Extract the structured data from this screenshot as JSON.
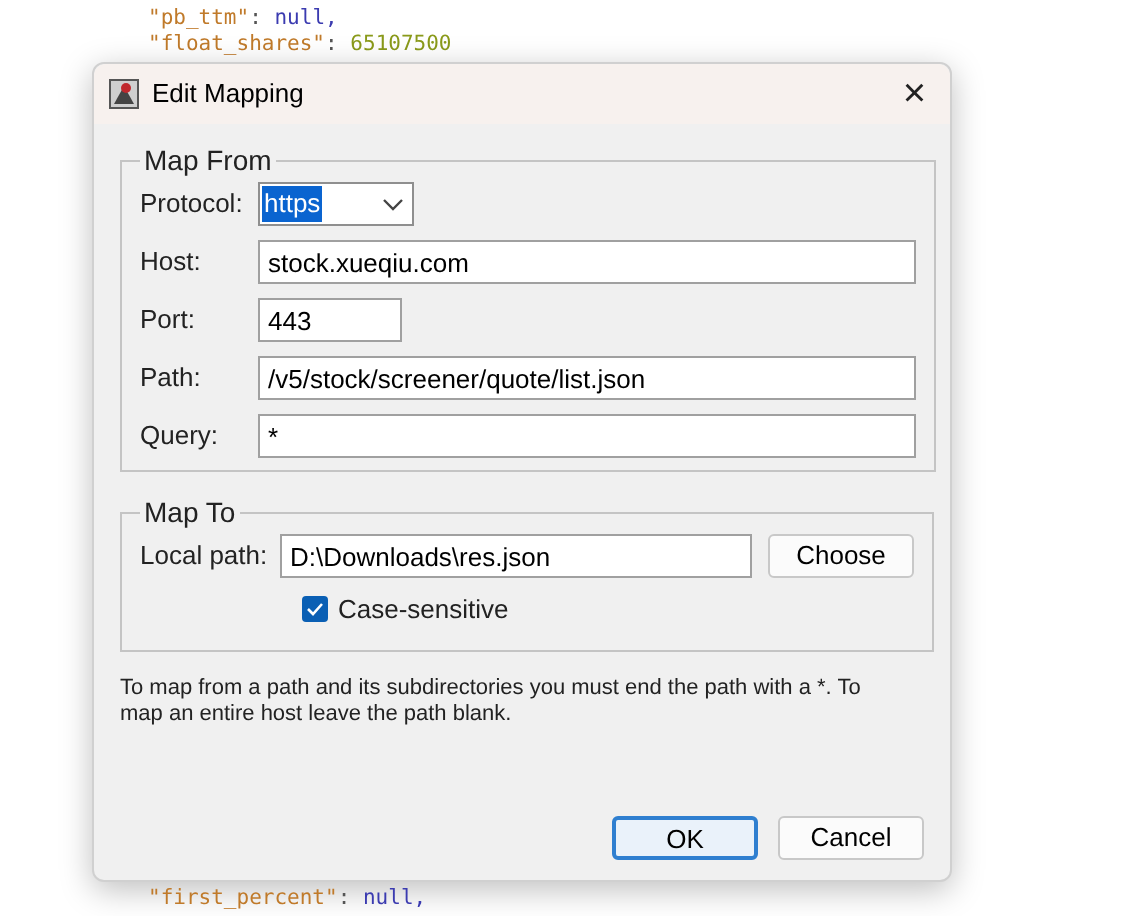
{
  "background_code": {
    "top": [
      {
        "key": "\"pb_ttm\"",
        "separator": ": ",
        "value": "null,",
        "kind": "null"
      },
      {
        "key": "\"float_shares\"",
        "separator": ": ",
        "value": "65107500",
        "kind": "number"
      }
    ],
    "bottom": [
      {
        "key": "\"first_percent\"",
        "separator": ": ",
        "value": "null,",
        "kind": "null"
      }
    ]
  },
  "dialog": {
    "title": "Edit Mapping",
    "close": "×",
    "map_from": {
      "legend": "Map From",
      "protocol": {
        "label": "Protocol:",
        "value": "https",
        "text_selected": true
      },
      "fields": [
        {
          "label": "Host:",
          "value": "stock.xueqiu.com",
          "kind": "wide"
        },
        {
          "label": "Port:",
          "value": "443",
          "kind": "short"
        },
        {
          "label": "Path:",
          "value": "/v5/stock/screener/quote/list.json",
          "kind": "wide"
        },
        {
          "label": "Query:",
          "value": "*",
          "kind": "wide"
        }
      ]
    },
    "map_to": {
      "legend": "Map To",
      "local_path": {
        "label": "Local path:",
        "value": "D:\\Downloads\\res.json"
      },
      "choose_button": "Choose",
      "case_sensitive": {
        "label": "Case-sensitive",
        "checked": true
      }
    },
    "note": "To map from a path and its subdirectories you must end the path with a *. To map an entire host leave the path blank.",
    "buttons": [
      {
        "label": "OK",
        "kind": "default"
      },
      {
        "label": "Cancel",
        "kind": "normal"
      }
    ]
  }
}
